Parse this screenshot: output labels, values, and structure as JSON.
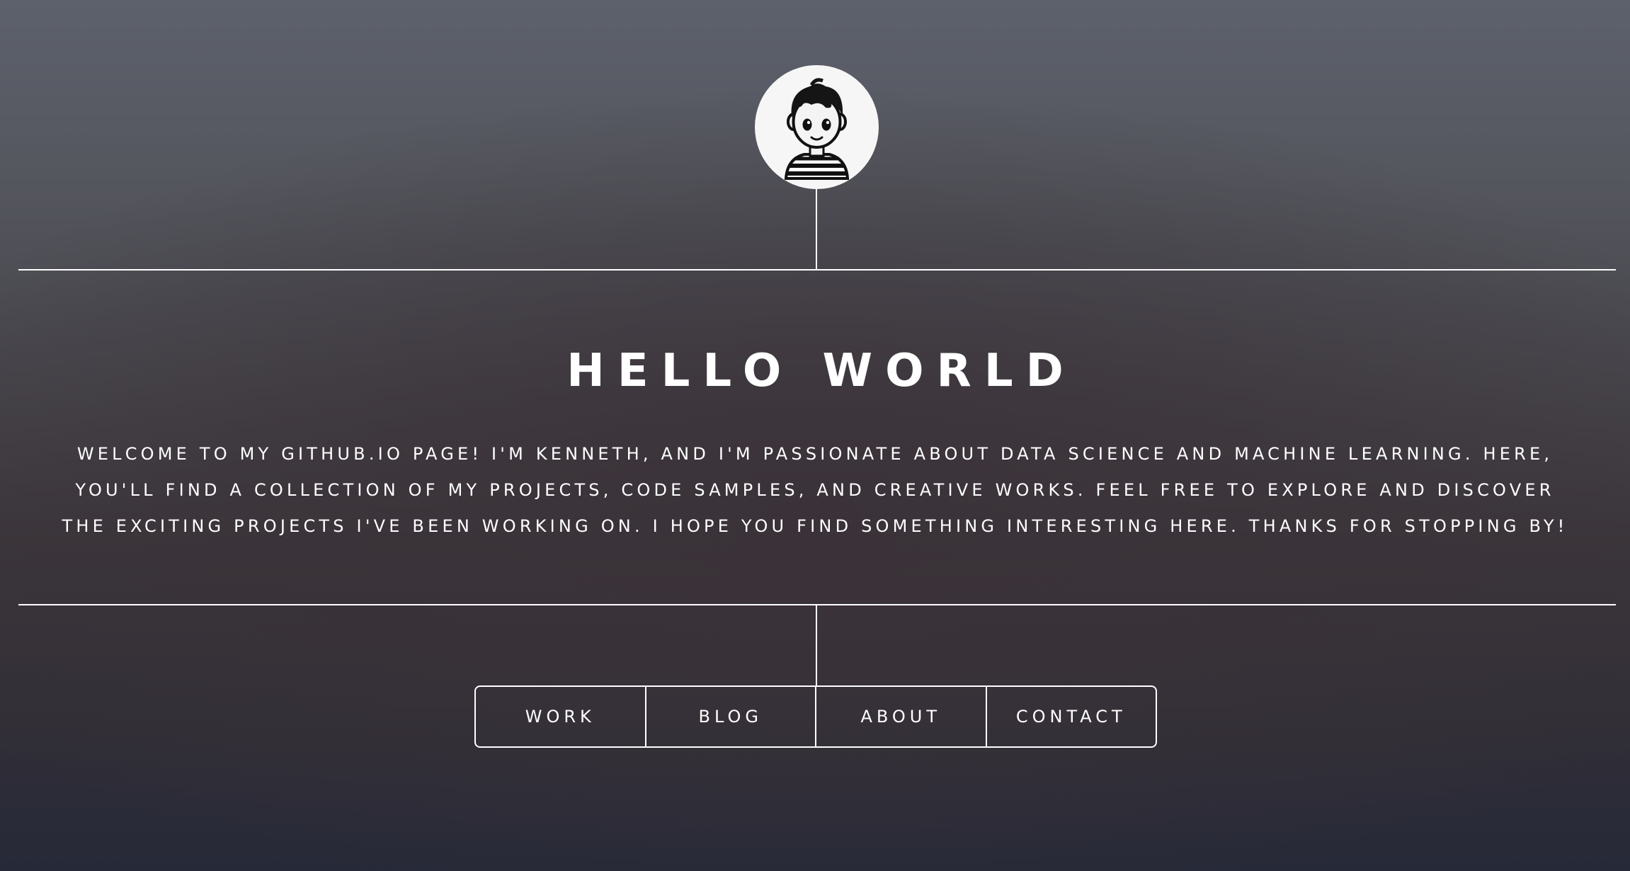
{
  "avatar": {
    "icon": "boy-avatar-icon",
    "alt": "cartoon avatar of a boy in a striped shirt"
  },
  "hero": {
    "title": "HELLO WORLD",
    "intro": "WELCOME TO MY GITHUB.IO PAGE! I'M KENNETH, AND I'M PASSIONATE ABOUT DATA SCIENCE AND MACHINE LEARNING. HERE, YOU'LL FIND A COLLECTION OF MY PROJECTS, CODE SAMPLES, AND CREATIVE WORKS. FEEL FREE TO EXPLORE AND DISCOVER THE EXCITING PROJECTS I'VE BEEN WORKING ON. I HOPE YOU FIND SOMETHING INTERESTING HERE. THANKS FOR STOPPING BY!"
  },
  "nav": {
    "items": [
      {
        "label": "WORK"
      },
      {
        "label": "BLOG"
      },
      {
        "label": "ABOUT"
      },
      {
        "label": "CONTACT"
      }
    ]
  },
  "colors": {
    "text": "#ffffff",
    "lines": "#ffffff",
    "background_top": "#5d616c",
    "background_mid": "#3b363b",
    "background_bottom": "#262938"
  }
}
